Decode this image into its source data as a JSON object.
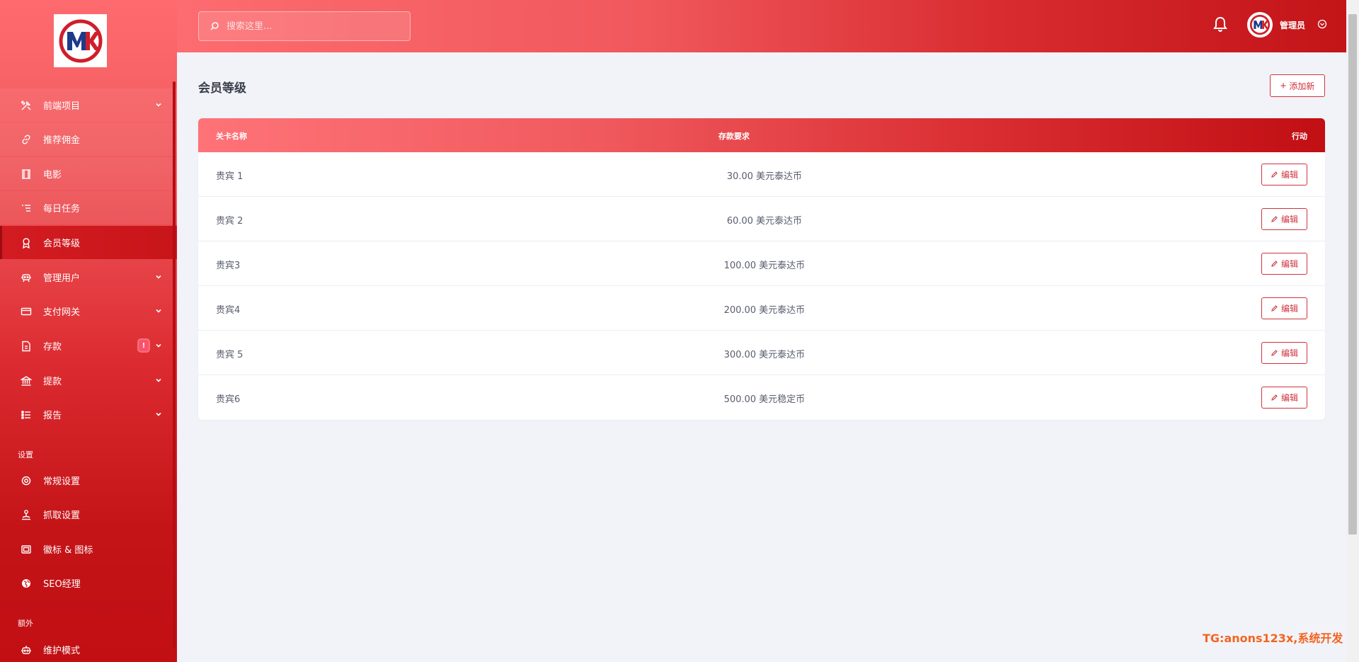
{
  "search": {
    "placeholder": "搜索这里..."
  },
  "header": {
    "user_name": "管理员"
  },
  "sidebar": {
    "items": [
      {
        "label": "前端项目",
        "icon": "tools-icon",
        "chevron": true
      },
      {
        "label": "推荐佣金",
        "icon": "link-icon",
        "chevron": false
      },
      {
        "label": "电影",
        "icon": "film-icon",
        "chevron": false
      },
      {
        "label": "每日任务",
        "icon": "list-icon",
        "chevron": false
      },
      {
        "label": "会员等级",
        "icon": "award-icon",
        "chevron": false,
        "active": true
      },
      {
        "label": "管理用户",
        "icon": "users-icon",
        "chevron": true
      },
      {
        "label": "支付网关",
        "icon": "credit-card-icon",
        "chevron": true
      },
      {
        "label": "存款",
        "icon": "deposit-icon",
        "chevron": true,
        "badge": "!"
      },
      {
        "label": "提款",
        "icon": "bank-icon",
        "chevron": true
      },
      {
        "label": "报告",
        "icon": "report-icon",
        "chevron": true
      }
    ],
    "section_settings": "设置",
    "settings_items": [
      {
        "label": "常规设置",
        "icon": "settings-icon"
      },
      {
        "label": "抓取设置",
        "icon": "scrape-icon"
      },
      {
        "label": "徽标 & 图标",
        "icon": "image-icon"
      },
      {
        "label": "SEO经理",
        "icon": "globe-icon"
      }
    ],
    "section_extra": "额外",
    "extra_items": [
      {
        "label": "维护模式",
        "icon": "robot-icon"
      }
    ]
  },
  "main": {
    "title": "会员等级",
    "add_label": "添加新",
    "add_symbol": "+",
    "columns": [
      "关卡名称",
      "存款要求",
      "行动"
    ],
    "edit_label": "编辑",
    "rows": [
      {
        "name": "贵宾 1",
        "requirement": "30.00 美元泰达币"
      },
      {
        "name": "贵宾 2",
        "requirement": "60.00 美元泰达币"
      },
      {
        "name": "贵宾3",
        "requirement": "100.00 美元泰达币"
      },
      {
        "name": "贵宾4",
        "requirement": "200.00 美元泰达币"
      },
      {
        "name": "贵宾 5",
        "requirement": "300.00 美元泰达币"
      },
      {
        "name": "贵宾6",
        "requirement": "500.00 美元稳定币"
      }
    ]
  },
  "watermark": "TG:anons123x,系统开发",
  "colors": {
    "accent": "#d0323d",
    "sidebar_top": "#fe6b6f",
    "sidebar_bottom": "#c10f14"
  }
}
